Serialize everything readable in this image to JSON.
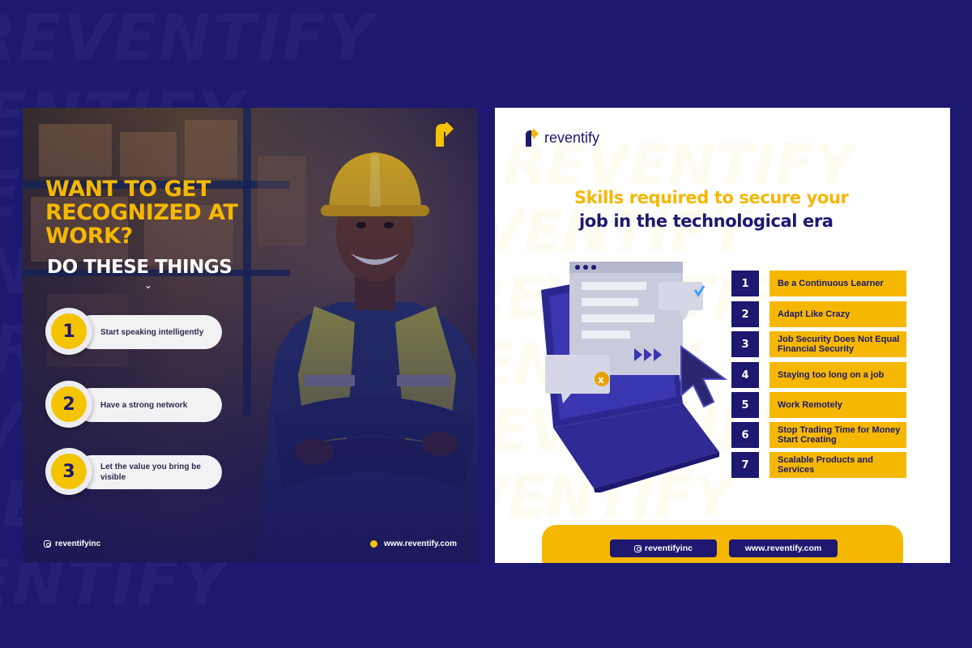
{
  "colors": {
    "background": "#1d1870",
    "accent": "#f5b700",
    "navy": "#1d1870",
    "white": "#ffffff"
  },
  "watermark": "REVENTIFY",
  "left_card": {
    "logo_icon": "reventify-logo-icon",
    "headline": "WANT TO GET RECOGNIZED AT WORK?",
    "subheadline": "DO THESE THINGS",
    "chevron_icon": "chevron-down-icon",
    "tips": [
      {
        "number": "1",
        "text": "Start speaking intelligently"
      },
      {
        "number": "2",
        "text": "Have a strong network"
      },
      {
        "number": "3",
        "text": "Let the value you bring be visible"
      }
    ],
    "footer": {
      "instagram_icon": "instagram-icon",
      "handle": "reventifyinc",
      "web_icon": "dot-icon",
      "website": "www.reventify.com"
    }
  },
  "right_card": {
    "logo_text": "reventify",
    "title_line1": "Skills required to secure your",
    "title_line2": "job in the technological era",
    "illustration": "laptop-illustration",
    "skills": [
      {
        "number": "1",
        "label": "Be a Continuous Learner"
      },
      {
        "number": "2",
        "label": "Adapt Like Crazy"
      },
      {
        "number": "3",
        "label": "Job Security Does Not Equal Financial Security"
      },
      {
        "number": "4",
        "label": "Staying too long on a job"
      },
      {
        "number": "5",
        "label": "Work Remotely"
      },
      {
        "number": "6",
        "label": "Stop Trading Time for Money Start Creating"
      },
      {
        "number": "7",
        "label": "Scalable Products and Services"
      }
    ],
    "footer": {
      "handle": "reventifyinc",
      "website": "www.reventify.com"
    }
  }
}
